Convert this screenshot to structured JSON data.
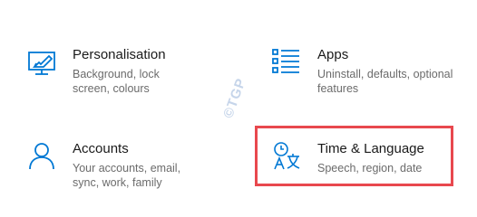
{
  "tiles": [
    {
      "title": "Personalisation",
      "description": "Background, lock screen, colours",
      "icon": "personalisation-icon"
    },
    {
      "title": "Apps",
      "description": "Uninstall, defaults, optional features",
      "icon": "apps-list-icon"
    },
    {
      "title": "Accounts",
      "description": "Your accounts, email, sync, work, family",
      "icon": "person-icon"
    },
    {
      "title": "Time & Language",
      "description": "Speech, region, date",
      "icon": "time-language-icon"
    }
  ],
  "watermark": "©TGP",
  "colors": {
    "accent": "#0078d4",
    "highlight": "#e8484e"
  }
}
